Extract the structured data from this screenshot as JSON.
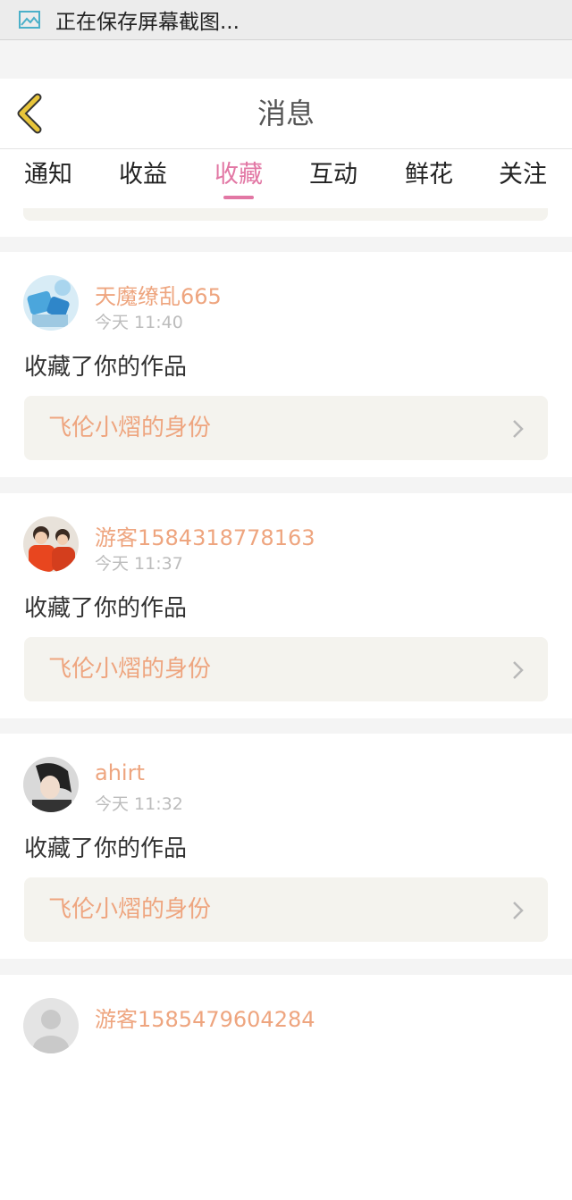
{
  "status_bar": {
    "text": "正在保存屏幕截图...",
    "icon": "screenshot-icon"
  },
  "header": {
    "title": "消息",
    "back_icon": "chevron-left-icon"
  },
  "tabs": [
    {
      "label": "通知",
      "active": false
    },
    {
      "label": "收益",
      "active": false
    },
    {
      "label": "收藏",
      "active": true
    },
    {
      "label": "互动",
      "active": false
    },
    {
      "label": "鲜花",
      "active": false
    },
    {
      "label": "关注",
      "active": false
    }
  ],
  "notifications": [
    {
      "user": "天魔缭乱665",
      "time": "今天 11:40",
      "action": "收藏了你的作品",
      "work": "飞伦小熠的身份"
    },
    {
      "user": "游客1584318778163",
      "time": "今天 11:37",
      "action": "收藏了你的作品",
      "work": "飞伦小熠的身份"
    },
    {
      "user": "ahirt",
      "time": "今天 11:32",
      "action": "收藏了你的作品",
      "work": "飞伦小熠的身份"
    },
    {
      "user": "游客1585479604284"
    }
  ],
  "colors": {
    "accent": "#e277a4",
    "username": "#eea57f",
    "back_icon": "#e8c53a"
  }
}
